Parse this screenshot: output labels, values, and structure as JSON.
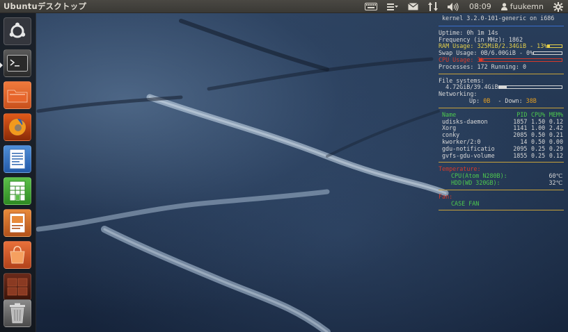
{
  "topbar": {
    "title": "Ubuntuデスクトップ",
    "time": "08:09",
    "username": "fuukemn",
    "icons": [
      "keyboard-icon",
      "menu-icon",
      "mail-icon",
      "network-arrows-icon",
      "volume-icon",
      "user-icon",
      "gear-icon"
    ]
  },
  "launcher": {
    "items": [
      {
        "name": "dash-home",
        "icon": "ubuntu-logo-icon"
      },
      {
        "name": "terminal",
        "icon": "terminal-icon"
      },
      {
        "name": "files",
        "icon": "folder-icon"
      },
      {
        "name": "firefox",
        "icon": "firefox-icon"
      },
      {
        "name": "writer",
        "icon": "document-icon"
      },
      {
        "name": "calc",
        "icon": "spreadsheet-icon"
      },
      {
        "name": "impress",
        "icon": "presentation-icon"
      },
      {
        "name": "software-center",
        "icon": "shopping-bag-icon"
      },
      {
        "name": "workspace-switcher",
        "icon": "workspaces-icon"
      },
      {
        "name": "trash",
        "icon": "trash-icon"
      }
    ]
  },
  "conky": {
    "kernel": "kernel 3.2.0-101-generic on i686",
    "uptime": "Uptime: 0h 1m 14s",
    "frequency": "Frequency (in MHz): 1862",
    "ram_label": "RAM Usage: 325MiB/2.34GiB - 13%",
    "ram_percent": 13,
    "swap_label": "Swap Usage: 0B/6.00GiB - 0%",
    "swap_percent": 0,
    "cpu_label": "CPU Usage: 3%",
    "cpu_percent": 3,
    "processes_label": "Processes: 172  Running: 0",
    "fs_header": "File systems:",
    "fs_value": "4.72GiB/39.4GiB",
    "fs_percent": 12,
    "net_header": "Networking:",
    "net_up_label": "Up:",
    "net_up_value": "0B",
    "net_down_label": "- Down:",
    "net_down_value": "38B",
    "proc_headers": [
      "Name",
      "PID",
      "CPU%",
      "MEM%"
    ],
    "processes": [
      [
        "udisks-daemon",
        "1857",
        "1.50",
        "0.12"
      ],
      [
        "Xorg",
        "1141",
        "1.00",
        "2.42"
      ],
      [
        "conky",
        "2085",
        "0.50",
        "0.21"
      ],
      [
        "kworker/2:0",
        "14",
        "0.50",
        "0.00"
      ],
      [
        "gdu-notificatio",
        "2095",
        "0.25",
        "0.29"
      ],
      [
        "gvfs-gdu-volume",
        "1855",
        "0.25",
        "0.12"
      ]
    ],
    "temps_header": "Temperature:",
    "cpu_temp_label": "CPU(Atom N280B):",
    "cpu_temp_value": "60℃",
    "hdd_temp_label": "HDD(WD 320GB):",
    "hdd_temp_value": "32℃",
    "fan_header": "Fan:",
    "fan_label": "CASE FAN"
  },
  "colors": {
    "panel": "#3a3935",
    "conky_text": "#d8d8d8",
    "conky_rule": "#c9a23a",
    "conky_yellow": "#e8d24a",
    "conky_red": "#d83a2a",
    "conky_green": "#4ec94e",
    "conky_orange": "#e8a020"
  }
}
